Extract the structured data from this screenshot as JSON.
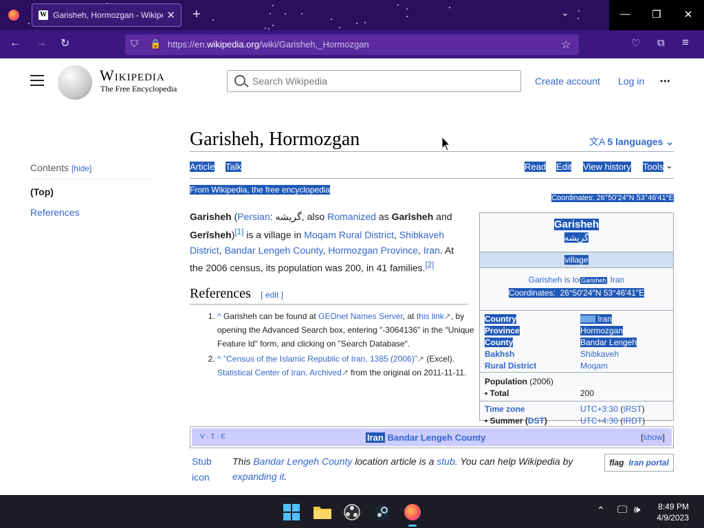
{
  "browser": {
    "tab_title": "Garisheh, Hormozgan - Wikipedia",
    "favicon_letter": "W",
    "new_tab": "+",
    "url_prefix": "https://en.",
    "url_domain": "wikipedia.org",
    "url_path": "/wiki/Garisheh,_Hormozgan",
    "icons": [
      "firefox-icon",
      "close-tab-icon",
      "new-tab-icon",
      "list-tabs-icon",
      "minimize-icon",
      "maximize-icon",
      "close-window-icon",
      "back-icon",
      "forward-icon",
      "reload-icon",
      "shield-icon",
      "lock-icon",
      "bookmark-star-icon",
      "pocket-icon",
      "extensions-icon",
      "menu-icon"
    ]
  },
  "header": {
    "wordmark": "Wikipedia",
    "tagline": "The Free Encyclopedia",
    "search_placeholder": "Search Wikipedia",
    "create_account": "Create account",
    "log_in": "Log in",
    "more": "•••"
  },
  "toc": {
    "title": "Contents",
    "hide": "[hide]",
    "items": [
      "(Top)",
      "References"
    ]
  },
  "article": {
    "title": "Garisheh, Hormozgan",
    "languages": "5 languages",
    "tabs_left": [
      "Article",
      "Talk"
    ],
    "tabs_right": [
      "Read",
      "Edit",
      "View history",
      "Tools"
    ],
    "from": "From Wikipedia, the free encyclopedia",
    "coordinates_label": "Coordinates:",
    "coordinates": "26°50′24″N 53°46′41″E",
    "lead": {
      "name": "Garisheh",
      "persian_link": "Persian",
      "persian": "گریشه",
      "also": ", also ",
      "romanized": "Romanized",
      "as": " as ",
      "alt1": "Garīsheh",
      "and": " and ",
      "alt2": "Gerīsheh",
      "ref1": "[1]",
      "is_village": " is a village in ",
      "l1": "Moqam Rural District",
      "l2": "Shibkaveh District",
      "l3": "Bandar Lengeh County",
      "l4": "Hormozgan Province",
      "l5": "Iran",
      "census": ". At the 2006 census, its population was 200, in 41 families.",
      "ref2": "[2]"
    },
    "references_heading": "References",
    "edit": "[ edit ]",
    "refs": [
      {
        "caret": "^",
        "text": " Garisheh can be found at ",
        "l1": "GEOnet Names Server",
        "t2": ", at ",
        "l2": "this link",
        "t3": ", by opening the Advanced Search box, entering \"-3064136\" in the \"Unique Feature Id\" form, and clicking on \"Search Database\"."
      },
      {
        "caret": "^",
        "l1": "\"Census of the Islamic Republic of Iran, 1385 (2006)\"",
        "t2": " (Excel). ",
        "l2": "Statistical Center of Iran",
        "t3": ". ",
        "l3": "Archived",
        "t4": " from the original on 2011-11-11."
      }
    ]
  },
  "infobox": {
    "title": "Garisheh",
    "native": "گریشه",
    "type": "village",
    "loc_text": "Garisheh is located in Iran",
    "pin_label": "Garisheh",
    "coordinates_label": "Coordinates:",
    "coordinates": "26°50′24″N 53°46′41″E",
    "rows": [
      {
        "k": "Country",
        "v": "Iran"
      },
      {
        "k": "Province",
        "v": "Hormozgan"
      },
      {
        "k": "County",
        "v": "Bandar Lengeh"
      },
      {
        "k": "Bakhsh",
        "v": "Shibkaveh"
      },
      {
        "k": "Rural District",
        "v": "Moqam"
      }
    ],
    "population_label": "Population",
    "population_year": "(2006)",
    "total_label": "• Total",
    "total": "200",
    "timezone_label": "Time zone",
    "timezone": "UTC+3:30",
    "irst": "IRST",
    "summer_label": "• Summer (",
    "dst": "DST",
    "summer": "UTC+4:30",
    "irdt": "IRDT"
  },
  "navbox": {
    "vte": "V · T · E",
    "flag": "Iran",
    "title": "Bandar Lengeh County",
    "show": "show"
  },
  "stub": {
    "icon_text": "Stub icon",
    "t1": "This ",
    "l1": "Bandar Lengeh County",
    "t2": " location article is a ",
    "l2": "stub",
    "t3": ". You can help Wikipedia by ",
    "l3": "expanding it",
    "t4": ".",
    "portal_flag": "flag",
    "portal": "Iran portal"
  },
  "taskbar": {
    "time": "8:49 PM",
    "date": "4/9/2023",
    "apps": [
      "windows-start-icon",
      "file-explorer-icon",
      "obs-icon",
      "steam-icon",
      "firefox-icon"
    ]
  }
}
